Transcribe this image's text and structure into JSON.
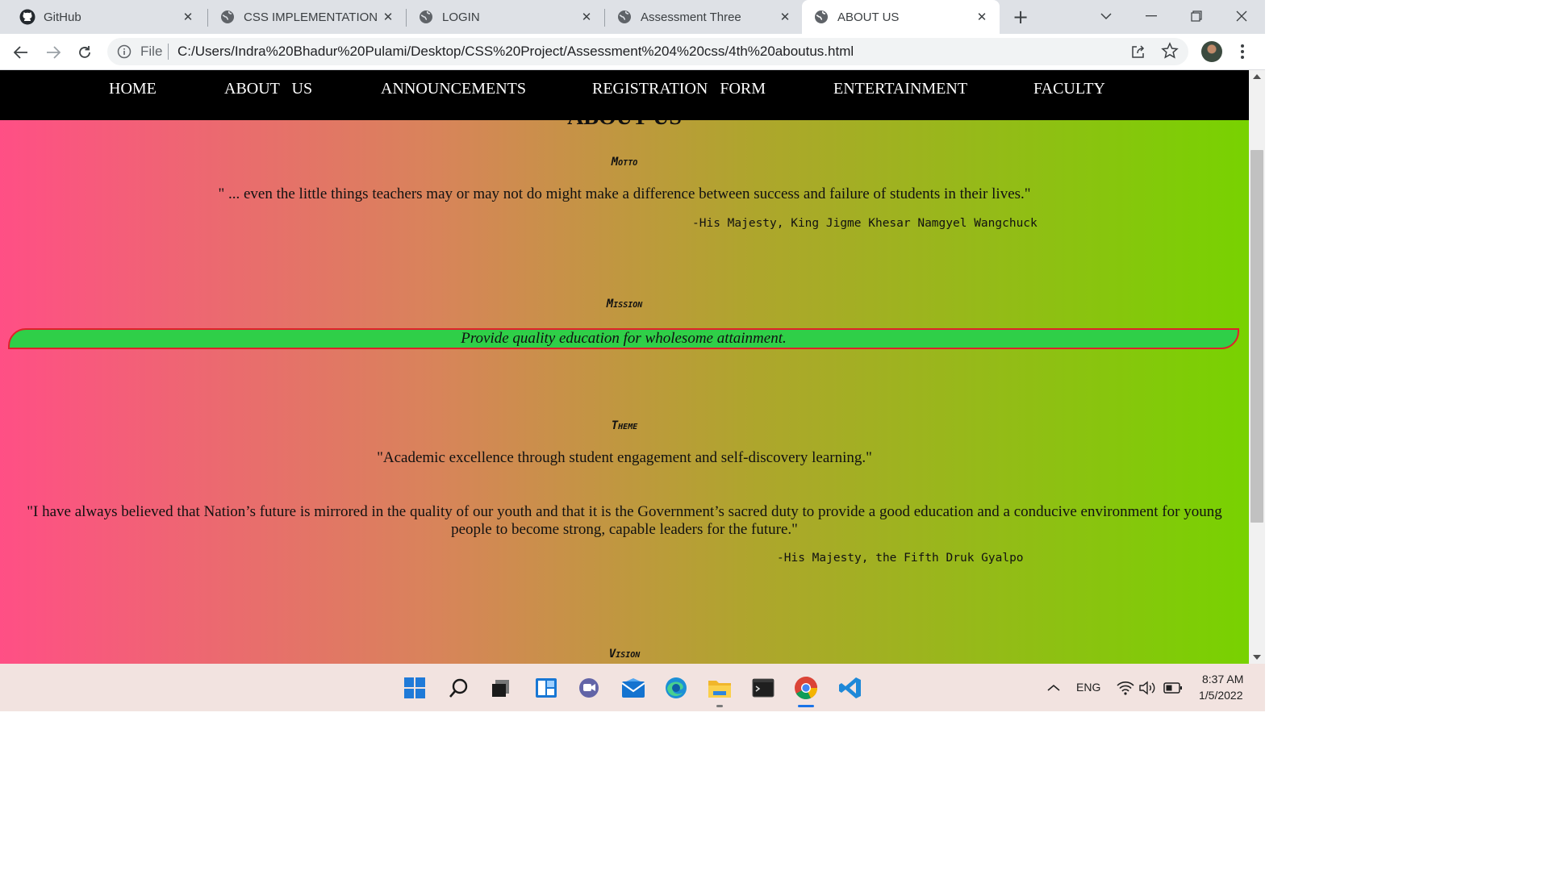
{
  "browser": {
    "tabs": [
      {
        "title": "GitHub",
        "icon": "github-icon",
        "active": false
      },
      {
        "title": "CSS IMPLEMENTATION",
        "icon": "globe-icon",
        "active": false
      },
      {
        "title": "LOGIN",
        "icon": "globe-icon",
        "active": false
      },
      {
        "title": "Assessment Three",
        "icon": "globe-icon",
        "active": false
      },
      {
        "title": "ABOUT US",
        "icon": "globe-icon",
        "active": true
      }
    ],
    "omnibox": {
      "scheme_label": "File",
      "url": "C:/Users/Indra%20Bhadur%20Pulami/Desktop/CSS%20Project/Assessment%204%20css/4th%20aboutus.html"
    }
  },
  "site_nav": {
    "items": [
      "HOME",
      "ABOUT   US",
      "ANNOUNCEMENTS",
      "REGISTRATION   FORM",
      "ENTERTAINMENT",
      "FACULTY"
    ]
  },
  "page": {
    "heading": "ABOUT US",
    "motto": {
      "heading": "Motto",
      "quote": "\" ... even the little things teachers may or may not do might make a difference between success and failure of students in their lives.\"",
      "attribution": "-His Majesty, King Jigme Khesar Namgyel Wangchuck"
    },
    "mission": {
      "heading": "Mission",
      "text": "Provide quality education for wholesome attainment."
    },
    "theme": {
      "heading": "Theme",
      "quote": "\"Academic excellence through student engagement and self-discovery learning.\"",
      "long_quote": "\"I have always believed that Nation’s future is mirrored in the quality of our youth and that it is the Government’s sacred duty to provide a good education and a conducive environment for young people to become strong, capable leaders for the future.\"",
      "attribution": "-His Majesty, the Fifth Druk Gyalpo"
    },
    "vision": {
      "heading": "Vision"
    }
  },
  "colors": {
    "gradient_left": "#ff4f85",
    "gradient_right": "#78d201",
    "mission_fill": "#2fcf48",
    "mission_border": "#e0212a",
    "nav_background": "#000000"
  },
  "taskbar": {
    "apps": [
      "start-icon",
      "search-icon",
      "task-view-icon",
      "widgets-icon",
      "chat-icon",
      "mail-icon",
      "edge-icon",
      "file-explorer-icon",
      "terminal-icon",
      "chrome-icon",
      "vscode-icon"
    ],
    "language": "ENG",
    "time": "8:37 AM",
    "date": "1/5/2022"
  }
}
